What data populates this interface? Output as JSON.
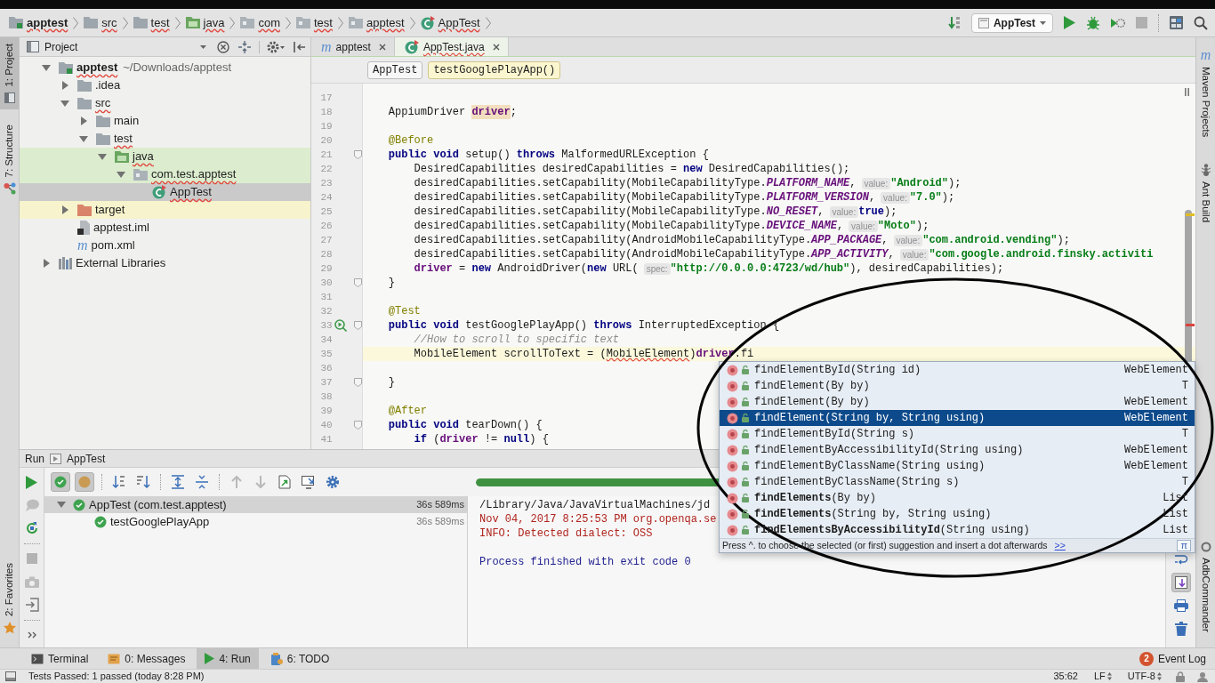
{
  "navigation_bar": {
    "breadcrumbs": [
      {
        "label": "apptest",
        "kind": "module",
        "typo": true
      },
      {
        "label": "src",
        "kind": "folder",
        "typo": true
      },
      {
        "label": "test",
        "kind": "folder",
        "typo": true
      },
      {
        "label": "java",
        "kind": "test-folder",
        "typo": true
      },
      {
        "label": "com",
        "kind": "package",
        "typo": true
      },
      {
        "label": "test",
        "kind": "package",
        "typo": true
      },
      {
        "label": "apptest",
        "kind": "package",
        "typo": true
      },
      {
        "label": "AppTest",
        "kind": "class",
        "typo": true
      }
    ],
    "toolbar": [
      {
        "kind": "sort",
        "disabled": false
      },
      {
        "kind": "run-config",
        "label": "AppTest",
        "disabled": false
      },
      {
        "kind": "run",
        "disabled": false
      },
      {
        "kind": "debug",
        "disabled": false
      },
      {
        "kind": "coverage",
        "disabled": false
      },
      {
        "kind": "stop",
        "disabled": true
      },
      {
        "kind": "structure",
        "disabled": false
      },
      {
        "kind": "search",
        "disabled": false
      }
    ]
  },
  "left_tool_strip": {
    "top_tabs": [
      {
        "label": "1: Project",
        "kind": "project",
        "selected": true
      },
      {
        "label": "7: Structure",
        "kind": "structure",
        "selected": false
      }
    ],
    "bottom_tabs": [
      {
        "label": "2: Favorites",
        "kind": "favorites",
        "selected": false
      }
    ]
  },
  "project_panel": {
    "title": "Project",
    "tree": [
      {
        "label": "apptest",
        "path": "~/Downloads/apptest",
        "kind": "module",
        "expanded": true,
        "selected": false,
        "test_source": false,
        "excluded": false,
        "typo": true,
        "children": [
          {
            "label": ".idea",
            "kind": "folder",
            "expanded": false,
            "selected": false,
            "test_source": false,
            "excluded": false,
            "typo": false
          },
          {
            "label": "src",
            "kind": "folder",
            "expanded": true,
            "selected": false,
            "test_source": false,
            "excluded": false,
            "typo": true,
            "children": [
              {
                "label": "main",
                "kind": "folder",
                "expanded": false,
                "selected": false,
                "test_source": false,
                "excluded": false,
                "typo": false
              },
              {
                "label": "test",
                "kind": "folder",
                "expanded": true,
                "selected": false,
                "test_source": false,
                "excluded": false,
                "typo": true,
                "children": [
                  {
                    "label": "java",
                    "kind": "test-folder",
                    "expanded": true,
                    "selected": false,
                    "test_source": true,
                    "typo": true,
                    "children": [
                      {
                        "label": "com.test.apptest",
                        "kind": "package",
                        "expanded": true,
                        "selected": false,
                        "test_source": true,
                        "typo": true,
                        "children": [
                          {
                            "label": "AppTest",
                            "kind": "class",
                            "selected": true,
                            "typo": true
                          }
                        ]
                      }
                    ]
                  }
                ]
              }
            ]
          },
          {
            "label": "target",
            "kind": "excluded-folder",
            "expanded": false,
            "selected": false,
            "excluded": true,
            "typo": false
          },
          {
            "label": "apptest.iml",
            "kind": "module-file",
            "selected": false,
            "test_source": false,
            "excluded": false,
            "typo": false
          },
          {
            "label": "pom.xml",
            "kind": "maven",
            "glyph": "m",
            "selected": false,
            "test_source": false,
            "excluded": false,
            "typo": false
          }
        ]
      },
      {
        "label": "External Libraries",
        "kind": "libraries",
        "expanded": false,
        "selected": false,
        "test_source": false,
        "excluded": false,
        "typo": false
      }
    ]
  },
  "editor": {
    "tabs": [
      {
        "label": "apptest",
        "kind": "maven",
        "glyph": "m",
        "selected": false,
        "typo": false
      },
      {
        "label": "AppTest.java",
        "kind": "class",
        "selected": true,
        "typo": true
      }
    ],
    "breadcrumbs": [
      {
        "label": "AppTest",
        "selected": false
      },
      {
        "label": "testGooglePlayApp()",
        "selected": true
      }
    ],
    "lines": [
      {
        "number": "17",
        "current": false,
        "fold": false,
        "run_icon": false
      },
      {
        "number": "18",
        "current": false,
        "fold": false,
        "run_icon": false,
        "tokens": [
          {
            "text": "    AppiumDriver ",
            "kind": "plain"
          },
          {
            "text": "driver",
            "kind": "field-usage"
          },
          {
            "text": ";",
            "kind": "plain"
          }
        ]
      },
      {
        "number": "19",
        "current": false,
        "fold": false,
        "run_icon": false
      },
      {
        "number": "20",
        "current": false,
        "fold": false,
        "run_icon": false,
        "tokens": [
          {
            "text": "    @Before",
            "kind": "annotation"
          }
        ]
      },
      {
        "number": "21",
        "current": false,
        "fold": true,
        "run_icon": false,
        "tokens": [
          {
            "text": "    public void",
            "kind": "keyword"
          },
          {
            "text": " setup() ",
            "kind": "plain"
          },
          {
            "text": "throws",
            "kind": "keyword"
          },
          {
            "text": " MalformedURLException {",
            "kind": "plain"
          }
        ]
      },
      {
        "number": "22",
        "current": false,
        "fold": false,
        "run_icon": false,
        "tokens": [
          {
            "text": "        DesiredCapabilities desiredCapabilities = ",
            "kind": "plain"
          },
          {
            "text": "new",
            "kind": "keyword"
          },
          {
            "text": " DesiredCapabilities();",
            "kind": "plain"
          }
        ]
      },
      {
        "number": "23",
        "current": false,
        "fold": false,
        "run_icon": false,
        "tokens": [
          {
            "text": "        desiredCapabilities.setCapability(MobileCapabilityType.",
            "kind": "plain"
          },
          {
            "text": "PLATFORM_NAME",
            "kind": "constant"
          },
          {
            "text": ",",
            "kind": "plain"
          },
          {
            "text": "value:",
            "kind": "hint"
          },
          {
            "text": "\"Android\"",
            "kind": "string"
          },
          {
            "text": ");",
            "kind": "plain"
          }
        ]
      },
      {
        "number": "24",
        "current": false,
        "fold": false,
        "run_icon": false,
        "tokens": [
          {
            "text": "        desiredCapabilities.setCapability(MobileCapabilityType.",
            "kind": "plain"
          },
          {
            "text": "PLATFORM_VERSION",
            "kind": "constant"
          },
          {
            "text": ",",
            "kind": "plain"
          },
          {
            "text": "value:",
            "kind": "hint"
          },
          {
            "text": "\"7.0\"",
            "kind": "string"
          },
          {
            "text": ");",
            "kind": "plain"
          }
        ]
      },
      {
        "number": "25",
        "current": false,
        "fold": false,
        "run_icon": false,
        "tokens": [
          {
            "text": "        desiredCapabilities.setCapability(MobileCapabilityType.",
            "kind": "plain"
          },
          {
            "text": "NO_RESET",
            "kind": "constant"
          },
          {
            "text": ",",
            "kind": "plain"
          },
          {
            "text": "value:",
            "kind": "hint"
          },
          {
            "text": "true",
            "kind": "keyword"
          },
          {
            "text": ");",
            "kind": "plain"
          }
        ]
      },
      {
        "number": "26",
        "current": false,
        "fold": false,
        "run_icon": false,
        "tokens": [
          {
            "text": "        desiredCapabilities.setCapability(MobileCapabilityType.",
            "kind": "plain"
          },
          {
            "text": "DEVICE_NAME",
            "kind": "constant"
          },
          {
            "text": ",",
            "kind": "plain"
          },
          {
            "text": "value:",
            "kind": "hint"
          },
          {
            "text": "\"Moto\"",
            "kind": "string"
          },
          {
            "text": ");",
            "kind": "plain"
          }
        ]
      },
      {
        "number": "27",
        "current": false,
        "fold": false,
        "run_icon": false,
        "tokens": [
          {
            "text": "        desiredCapabilities.setCapability(AndroidMobileCapabilityType.",
            "kind": "plain"
          },
          {
            "text": "APP_PACKAGE",
            "kind": "constant"
          },
          {
            "text": ",",
            "kind": "plain"
          },
          {
            "text": "value:",
            "kind": "hint"
          },
          {
            "text": "\"com.android.vending\"",
            "kind": "string"
          },
          {
            "text": ");",
            "kind": "plain"
          }
        ]
      },
      {
        "number": "28",
        "current": false,
        "fold": false,
        "run_icon": false,
        "tokens": [
          {
            "text": "        desiredCapabilities.setCapability(AndroidMobileCapabilityType.",
            "kind": "plain"
          },
          {
            "text": "APP_ACTIVITY",
            "kind": "constant"
          },
          {
            "text": ",",
            "kind": "plain"
          },
          {
            "text": "value:",
            "kind": "hint"
          },
          {
            "text": "\"com.google.android.finsky.activiti",
            "kind": "string"
          }
        ]
      },
      {
        "number": "29",
        "current": false,
        "fold": false,
        "run_icon": false,
        "tokens": [
          {
            "text": "        driver",
            "kind": "field"
          },
          {
            "text": " = ",
            "kind": "plain"
          },
          {
            "text": "new",
            "kind": "keyword"
          },
          {
            "text": " AndroidDriver(",
            "kind": "plain"
          },
          {
            "text": "new",
            "kind": "keyword"
          },
          {
            "text": " URL(",
            "kind": "plain"
          },
          {
            "text": "spec:",
            "kind": "hint"
          },
          {
            "text": "\"http://0.0.0.0:4723/wd/hub\"",
            "kind": "string"
          },
          {
            "text": "), desiredCapabilities);",
            "kind": "plain"
          }
        ]
      },
      {
        "number": "30",
        "current": false,
        "fold": true,
        "run_icon": false,
        "tokens": [
          {
            "text": "    }",
            "kind": "plain"
          }
        ]
      },
      {
        "number": "31",
        "current": false,
        "fold": false,
        "run_icon": false
      },
      {
        "number": "32",
        "current": false,
        "fold": false,
        "run_icon": false,
        "tokens": [
          {
            "text": "    @Test",
            "kind": "annotation"
          }
        ]
      },
      {
        "number": "33",
        "current": false,
        "fold": true,
        "run_icon": true,
        "tokens": [
          {
            "text": "    public void",
            "kind": "keyword"
          },
          {
            "text": " testGooglePlayApp() ",
            "kind": "plain"
          },
          {
            "text": "throws",
            "kind": "keyword"
          },
          {
            "text": " InterruptedException {",
            "kind": "plain"
          }
        ]
      },
      {
        "number": "34",
        "current": false,
        "fold": false,
        "run_icon": false,
        "tokens": [
          {
            "text": "        //How to scroll to specific text",
            "kind": "comment"
          }
        ]
      },
      {
        "number": "35",
        "current": true,
        "fold": false,
        "run_icon": false,
        "tokens": [
          {
            "text": "        MobileElement scrollToText = (",
            "kind": "plain"
          },
          {
            "text": "MobileElement",
            "kind": "error"
          },
          {
            "text": ")",
            "kind": "plain"
          },
          {
            "text": "driver",
            "kind": "field"
          },
          {
            "text": ".fi",
            "kind": "plain"
          }
        ]
      },
      {
        "number": "36",
        "current": false,
        "fold": false,
        "run_icon": false
      },
      {
        "number": "37",
        "current": false,
        "fold": true,
        "run_icon": false,
        "tokens": [
          {
            "text": "    }",
            "kind": "plain"
          }
        ]
      },
      {
        "number": "38",
        "current": false,
        "fold": false,
        "run_icon": false
      },
      {
        "number": "39",
        "current": false,
        "fold": false,
        "run_icon": false,
        "tokens": [
          {
            "text": "    @After",
            "kind": "annotation"
          }
        ]
      },
      {
        "number": "40",
        "current": false,
        "fold": true,
        "run_icon": false,
        "tokens": [
          {
            "text": "    public void",
            "kind": "keyword"
          },
          {
            "text": " tearDown() {",
            "kind": "plain"
          }
        ]
      },
      {
        "number": "41",
        "current": false,
        "fold": false,
        "run_icon": false,
        "tokens": [
          {
            "text": "        if",
            "kind": "keyword"
          },
          {
            "text": " (",
            "kind": "plain"
          },
          {
            "text": "driver",
            "kind": "field"
          },
          {
            "text": " != ",
            "kind": "plain"
          },
          {
            "text": "null",
            "kind": "keyword"
          },
          {
            "text": ") {",
            "kind": "plain"
          }
        ]
      }
    ]
  },
  "completion_popup": {
    "items": [
      {
        "signature": "findElementById(String id)",
        "type": "WebElement",
        "selected": false
      },
      {
        "signature": "findElement(By by)",
        "type": "T",
        "selected": false
      },
      {
        "signature": "findElement(By by)",
        "type": "WebElement",
        "selected": false
      },
      {
        "signature": "findElement(String by, String using)",
        "type": "WebElement",
        "selected": true
      },
      {
        "signature": "findElementById(String s)",
        "type": "T",
        "selected": false
      },
      {
        "signature": "findElementByAccessibilityId(String using)",
        "type": "WebElement",
        "selected": false
      },
      {
        "signature": "findElementByClassName(String using)",
        "type": "WebElement",
        "selected": false
      },
      {
        "signature": "findElementByClassName(String s)",
        "type": "T",
        "selected": false
      },
      {
        "signature": "**findElements**(By by)",
        "type": "List",
        "selected": false
      },
      {
        "signature": "**findElements**(String by, String using)",
        "type": "List",
        "selected": false
      },
      {
        "signature": "**findElementsByAccessibilityId**(String using)",
        "type": "List",
        "selected": false
      }
    ],
    "hint": "Press ^. to choose the selected (or first) suggestion and insert a dot afterwards",
    "more_link": ">>",
    "symbol_button": "π"
  },
  "run_panel": {
    "title": "Run",
    "configuration": "AppTest",
    "side_toolbar": [
      {
        "kind": "rerun",
        "disabled": false
      },
      {
        "kind": "rerun-failed",
        "disabled": true
      },
      {
        "kind": "auto-test",
        "disabled": false
      },
      {
        "kind": "stop",
        "disabled": true
      },
      {
        "kind": "screenshot",
        "disabled": true
      },
      {
        "kind": "exit",
        "disabled": false
      },
      {
        "kind": "more",
        "disabled": false
      }
    ],
    "toolbar": [
      {
        "kind": "show-passed",
        "pressed": true,
        "disabled": false
      },
      {
        "kind": "show-ignored",
        "pressed": true,
        "disabled": false
      },
      {
        "kind": "sort-alpha",
        "pressed": false,
        "disabled": false
      },
      {
        "kind": "sort-duration",
        "pressed": false,
        "disabled": false
      },
      {
        "kind": "expand-all",
        "pressed": false,
        "disabled": false
      },
      {
        "kind": "collapse-all",
        "pressed": false,
        "disabled": false
      },
      {
        "kind": "previous",
        "pressed": false,
        "disabled": true
      },
      {
        "kind": "next",
        "pressed": false,
        "disabled": true
      },
      {
        "kind": "export",
        "pressed": false,
        "disabled": false
      },
      {
        "kind": "import",
        "pressed": false,
        "disabled": false
      },
      {
        "kind": "settings",
        "pressed": false,
        "disabled": false
      }
    ],
    "progress": {
      "level": 1
    },
    "tests": [
      {
        "label": "AppTest (com.test.apptest)",
        "duration": "36s 589ms",
        "expanded": true,
        "selected": true,
        "children": [
          {
            "label": "testGooglePlayApp",
            "duration": "36s 589ms",
            "selected": false
          }
        ]
      }
    ],
    "console": [
      {
        "text": "/Library/Java/JavaVirtualMachines/jd",
        "kind": "command"
      },
      {
        "text": "Nov 04, 2017 8:25:53 PM org.openqa.se",
        "kind": "stderr"
      },
      {
        "text": "INFO: Detected dialect: OSS",
        "kind": "stderr"
      },
      {
        "text": "Process finished with exit code 0",
        "kind": "exit"
      }
    ],
    "console_toolbar": [
      {
        "kind": "wrap",
        "pressed": false
      },
      {
        "kind": "scroll-to-end",
        "pressed": true
      },
      {
        "kind": "print",
        "pressed": false
      },
      {
        "kind": "clear",
        "pressed": false
      }
    ]
  },
  "right_tool_strip": {
    "top_tabs": [
      {
        "label": "Maven Projects",
        "kind": "maven",
        "glyph": "m",
        "selected": false
      },
      {
        "label": "Ant Build",
        "kind": "ant",
        "selected": false
      }
    ],
    "bottom_tabs": [
      {
        "label": "AdbCommander",
        "kind": "adb",
        "selected": false
      }
    ]
  },
  "bottom_bar": {
    "tabs": [
      {
        "label": "Terminal",
        "kind": "terminal",
        "selected": false
      },
      {
        "label": "0: Messages",
        "kind": "messages",
        "selected": false
      },
      {
        "label": "4: Run",
        "kind": "run",
        "selected": true
      },
      {
        "label": "6: TODO",
        "kind": "todo",
        "selected": false
      }
    ],
    "event_log": {
      "label": "Event Log",
      "count": "2"
    }
  },
  "status_bar": {
    "message": "Tests Passed: 1 passed (today 8:28 PM)",
    "position": "35:62",
    "line_separator": "LF",
    "encoding": "UTF-8"
  }
}
